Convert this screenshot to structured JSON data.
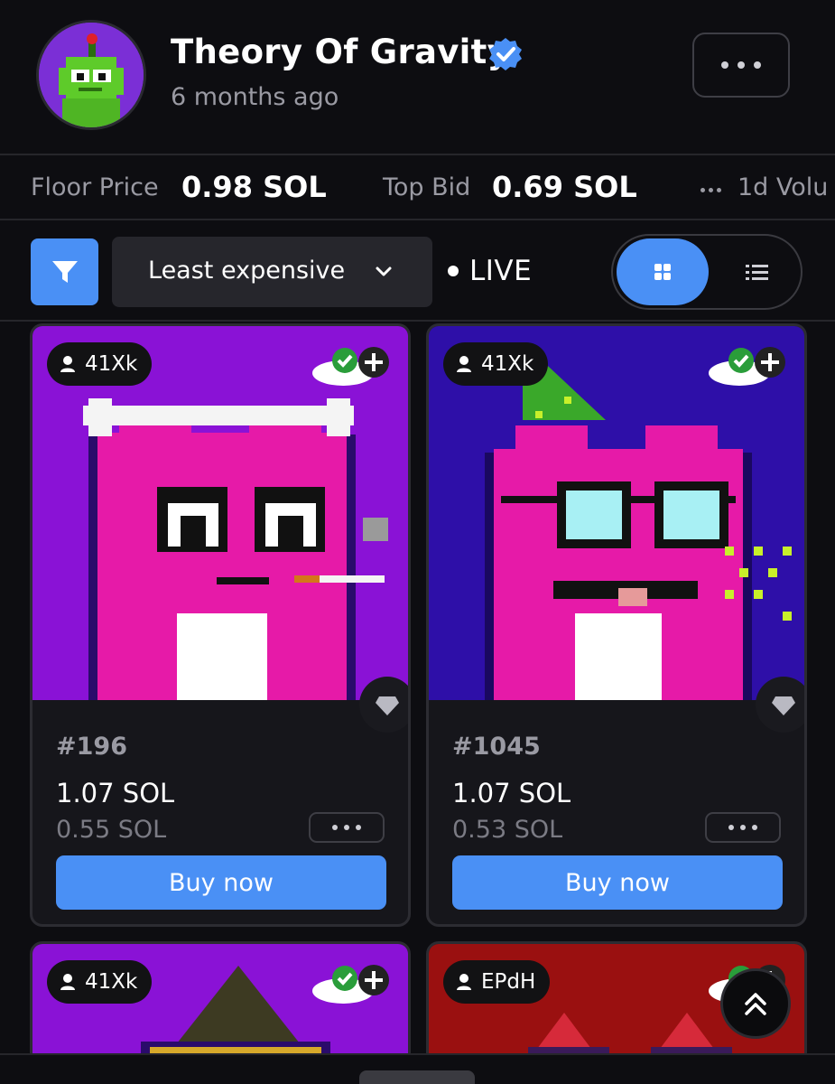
{
  "header": {
    "title": "Theory Of Gravity",
    "subtitle": "6 months ago",
    "verified_icon": "verified-check-icon",
    "more_icon": "more-horizontal-icon"
  },
  "stats": [
    {
      "label": "Floor Price",
      "value": "0.98 SOL"
    },
    {
      "label": "Top Bid",
      "value": "0.69 SOL"
    },
    {
      "label": "1d Volu",
      "value": ""
    }
  ],
  "toolbar": {
    "filter_icon": "filter-funnel-icon",
    "sort_label": "Least expensive",
    "live_label": "LIVE",
    "view_modes": [
      "grid",
      "list"
    ],
    "active_view": "grid"
  },
  "cards": [
    {
      "owner": "41Xk",
      "id": "#196",
      "price": "1.07 SOL",
      "bid": "0.55 SOL",
      "buy_label": "Buy now"
    },
    {
      "owner": "41Xk",
      "id": "#1045",
      "price": "1.07 SOL",
      "bid": "0.53 SOL",
      "buy_label": "Buy now"
    },
    {
      "owner": "41Xk"
    },
    {
      "owner": "EPdH"
    }
  ],
  "colors": {
    "accent": "#4a90f5",
    "background": "#0d0d11",
    "card": "#16161b",
    "muted_text": "#9a9aa3"
  }
}
